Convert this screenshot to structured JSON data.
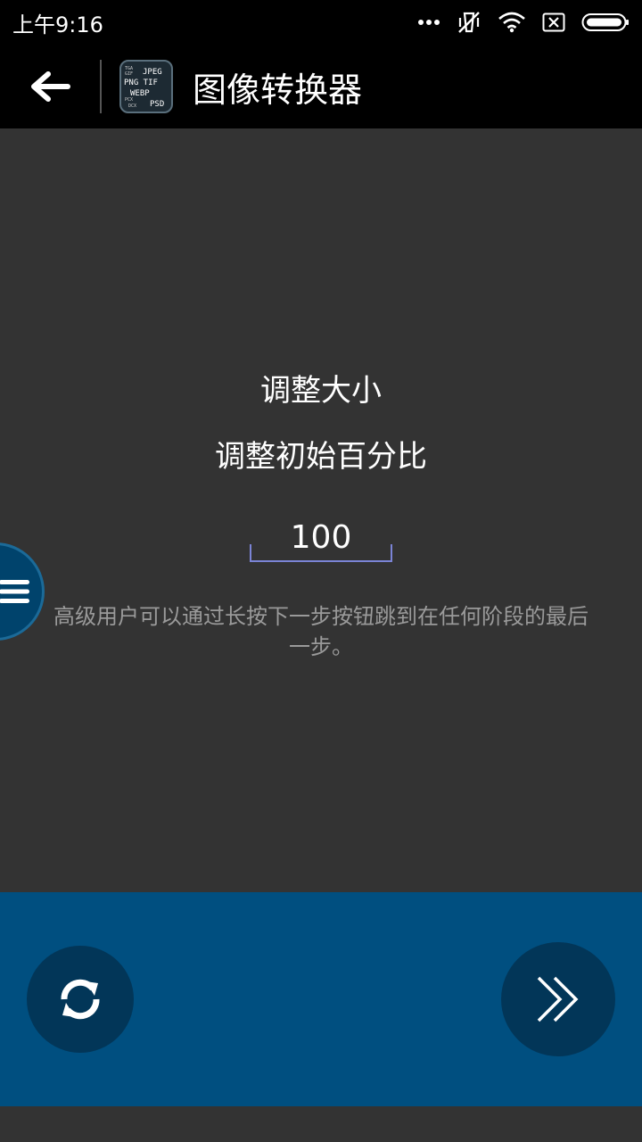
{
  "statusbar": {
    "time": "上午9:16"
  },
  "appbar": {
    "title": "图像转换器",
    "back_icon": "arrow-left-icon",
    "logo": {
      "lines": [
        "JPEG",
        "PNG TIF",
        "WEBP",
        "PSD"
      ],
      "small_labels": [
        "TGA",
        "GIF",
        "PCX",
        "DCX"
      ]
    }
  },
  "main": {
    "heading": "调整大小",
    "subheading": "调整初始百分比",
    "percent_value": "100",
    "hint": "高级用户可以通过长按下一步按钮跳到在任何阶段的最后一步。"
  },
  "colors": {
    "background": "#333333",
    "bars": "#000000",
    "bottom_bar": "#004f80",
    "button_bg": "#023658",
    "underline": "#7b84d6",
    "hint_text": "#9a9a9a"
  },
  "icons": {
    "side_menu": "hamburger-menu-icon",
    "reset": "refresh-icon",
    "next": "double-chevron-right-icon"
  }
}
